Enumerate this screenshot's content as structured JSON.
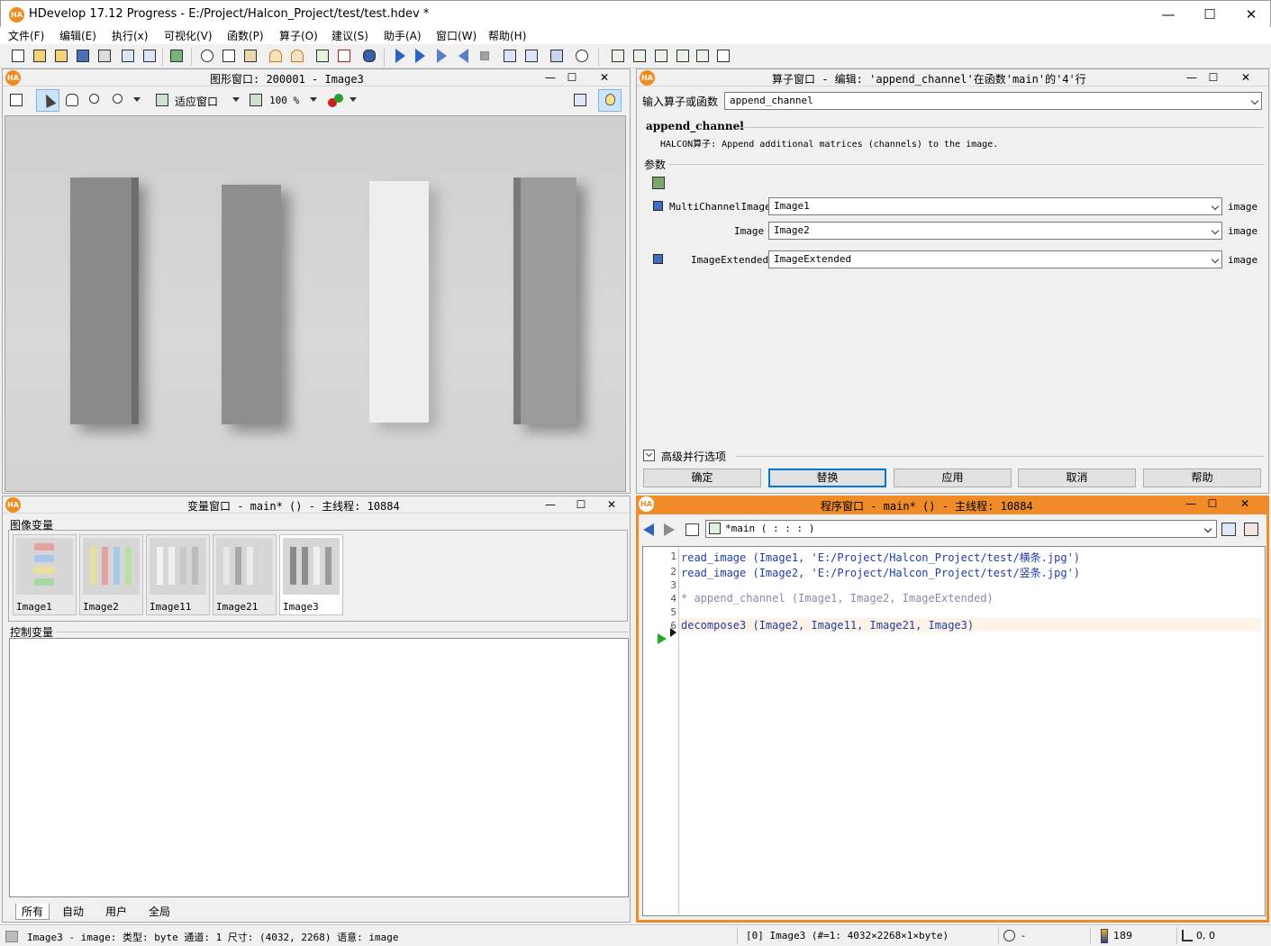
{
  "window": {
    "title": "HDevelop 17.12 Progress - E:/Project/Halcon_Project/test/test.hdev *",
    "logo": "HA",
    "minimize": "—",
    "maximize": "☐",
    "close": "✕"
  },
  "menu": [
    "文件(F)",
    "编辑(E)",
    "执行(x)",
    "可视化(V)",
    "函数(P)",
    "算子(O)",
    "建议(S)",
    "助手(A)",
    "窗口(W)",
    "帮助(H)"
  ],
  "graphics": {
    "title": "图形窗口: 200001 - Image3",
    "fit_label": "适应窗口",
    "zoom_label": "100 %"
  },
  "operator": {
    "title": "算子窗口 - 编辑: 'append_channel'在函数'main'的'4'行",
    "input_label": "输入算子或函数",
    "input_value": "append_channel",
    "name": "append_channel",
    "description": "HALCON算子: Append additional matrices (channels) to the image.",
    "params_label": "参数",
    "params": [
      {
        "name": "MultiChannelImage",
        "value": "Image1",
        "type": "image"
      },
      {
        "name": "Image",
        "value": "Image2",
        "type": "image"
      },
      {
        "name": "ImageExtended",
        "value": "ImageExtended",
        "type": "image"
      }
    ],
    "advanced_label": "高级并行选项",
    "buttons": {
      "ok": "确定",
      "replace": "替换",
      "apply": "应用",
      "cancel": "取消",
      "help": "帮助"
    }
  },
  "variables": {
    "title": "变量窗口 - main* () - 主线程: 10884",
    "image_section": "图像变量",
    "images": [
      "Image1",
      "Image2",
      "Image11",
      "Image21",
      "Image3"
    ],
    "control_section": "控制变量",
    "tabs": [
      "所有",
      "自动",
      "用户",
      "全局"
    ]
  },
  "program": {
    "title": "程序窗口 - main* () - 主线程: 10884",
    "procedure": "*main ( : : : )",
    "lines": [
      {
        "num": "1",
        "text": "read_image (Image1, 'E:/Project/Halcon_Project/test/横条.jpg')",
        "kind": "code"
      },
      {
        "num": "2",
        "text": "read_image (Image2, 'E:/Project/Halcon_Project/test/竖条.jpg')",
        "kind": "code"
      },
      {
        "num": "3",
        "text": "",
        "kind": "code"
      },
      {
        "num": "4",
        "text": "* append_channel (Image1, Image2, ImageExtended)",
        "kind": "comment"
      },
      {
        "num": "5",
        "text": "",
        "kind": "code"
      },
      {
        "num": "6",
        "text": "decompose3 (Image2, Image11, Image21, Image3)",
        "kind": "code"
      }
    ]
  },
  "status": {
    "info": "Image3 - image: 类型: byte 通道: 1 尺寸: (4032, 2268) 语意: image",
    "pixel": "[0] Image3 (#=1: 4032×2268×1×byte)",
    "timer": "-",
    "gray": "189",
    "coords": "0, 0"
  },
  "colors": {
    "accent": "#f08c28",
    "code_blue": "#1f3da8",
    "comment_gray": "#8a8aa8"
  }
}
